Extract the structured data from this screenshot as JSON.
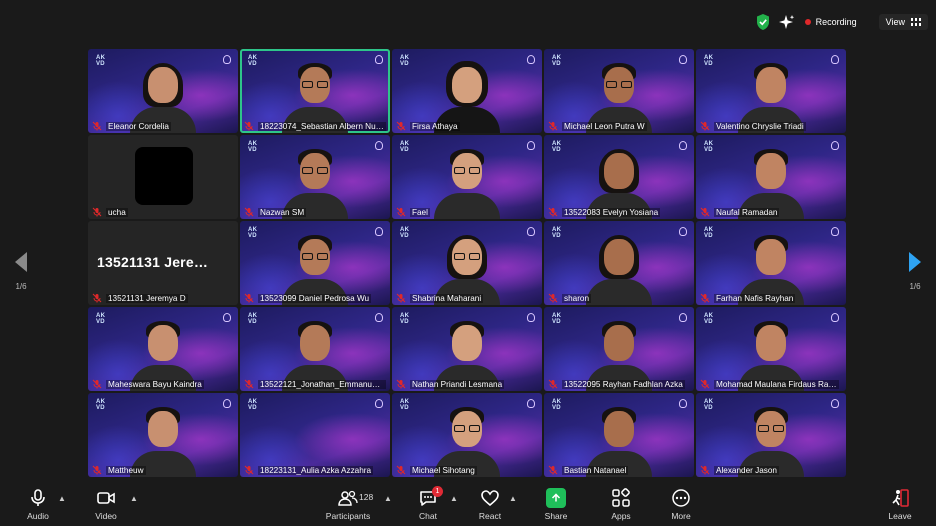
{
  "status": {
    "recording_label": "Recording",
    "view_label": "View"
  },
  "tile_brand": "AK\nVD",
  "participants": [
    {
      "name": "Eleanor Cordelia",
      "style": "long",
      "glasses": false
    },
    {
      "name": "18223074_Sebastian Albern Nugro…",
      "style": "short",
      "glasses": true,
      "active": true
    },
    {
      "name": "Firsa Athaya",
      "style": "hijab",
      "glasses": false
    },
    {
      "name": "Michael Leon Putra W",
      "style": "short",
      "glasses": true
    },
    {
      "name": "Valentino Chryslie Triadi",
      "style": "short",
      "glasses": false
    },
    {
      "name": "ucha",
      "style": "avatar",
      "glasses": false
    },
    {
      "name": "Nazwan SM",
      "style": "short",
      "glasses": true
    },
    {
      "name": "Fael",
      "style": "short",
      "glasses": true
    },
    {
      "name": "13522083 Evelyn Yosiana",
      "style": "long",
      "glasses": false
    },
    {
      "name": "Naufal Ramadan",
      "style": "short",
      "glasses": false
    },
    {
      "name": "13521131 Jeremya D",
      "style": "namecard",
      "big": "13521131 Jere…"
    },
    {
      "name": "13523099 Daniel Pedrosa Wu",
      "style": "short",
      "glasses": true
    },
    {
      "name": "Shabrina Maharani",
      "style": "long",
      "glasses": true
    },
    {
      "name": "sharon",
      "style": "long",
      "glasses": false
    },
    {
      "name": "Farhan Nafis Rayhan",
      "style": "short",
      "glasses": false
    },
    {
      "name": "Maheswara Bayu Kaindra",
      "style": "short",
      "glasses": false
    },
    {
      "name": "13522121_Jonathan_Emmanuel…",
      "style": "short",
      "glasses": false
    },
    {
      "name": "Nathan Priandi Lesmana",
      "style": "short",
      "glasses": false
    },
    {
      "name": "13522095 Rayhan Fadhlan Azka",
      "style": "short",
      "glasses": false
    },
    {
      "name": "Mohamad Maulana Firdaus Ra…",
      "style": "short",
      "glasses": false
    },
    {
      "name": "Mattheuw",
      "style": "short",
      "glasses": false
    },
    {
      "name": "18223131_Aulia Azka Azzahra",
      "style": "empty",
      "glasses": false
    },
    {
      "name": "Michael Sihotang",
      "style": "short",
      "glasses": true
    },
    {
      "name": "Bastian Natanael",
      "style": "short",
      "glasses": false
    },
    {
      "name": "Alexander Jason",
      "style": "short",
      "glasses": true
    }
  ],
  "pager": {
    "left": "1/6",
    "right": "1/6"
  },
  "toolbar": {
    "audio": "Audio",
    "video": "Video",
    "participants": "Participants",
    "participant_count": "128",
    "chat": "Chat",
    "chat_badge": "1",
    "react": "React",
    "share": "Share",
    "apps": "Apps",
    "more": "More",
    "leave": "Leave"
  },
  "colors": {
    "accent_active": "#2ec58a",
    "recording": "#e0282a",
    "share": "#1fbf5a",
    "pager_active": "#2ea3f2",
    "badge": "#e02a35"
  }
}
